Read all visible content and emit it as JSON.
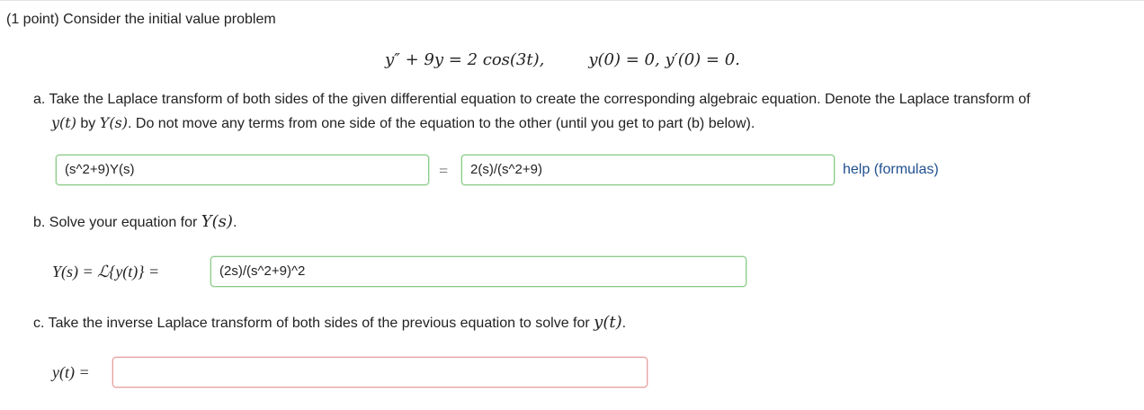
{
  "problem": {
    "intro": "(1 point) Consider the initial value problem",
    "equation": "y″ + 9y = 2 cos(3t),",
    "initial_conditions": "y(0) = 0,   y′(0) = 0."
  },
  "part_a": {
    "text_1": "a. Take the Laplace transform of both sides of the given differential equation to create the corresponding algebraic equation. Denote the Laplace transform of",
    "yt": "y(t)",
    "by": " by ",
    "Ys": "Y(s)",
    "text_2": ". Do not move any terms from one side of the equation to the other (until you get to part (b) below).",
    "lhs_value": "(s^2+9)Y(s)",
    "equals": "=",
    "rhs_value": "2(s)/(s^2+9)",
    "help_label": "help (formulas)"
  },
  "part_b": {
    "text": "b. Solve your equation for ",
    "Ys": "Y(s)",
    "period": ".",
    "label": "Y(s) = ℒ{y(t)} =",
    "value": "(2s)/(s^2+9)^2"
  },
  "part_c": {
    "text": "c. Take the inverse Laplace transform of both sides of the previous equation to solve for ",
    "yt": "y(t)",
    "period": ".",
    "label": "y(t) =",
    "value": ""
  }
}
